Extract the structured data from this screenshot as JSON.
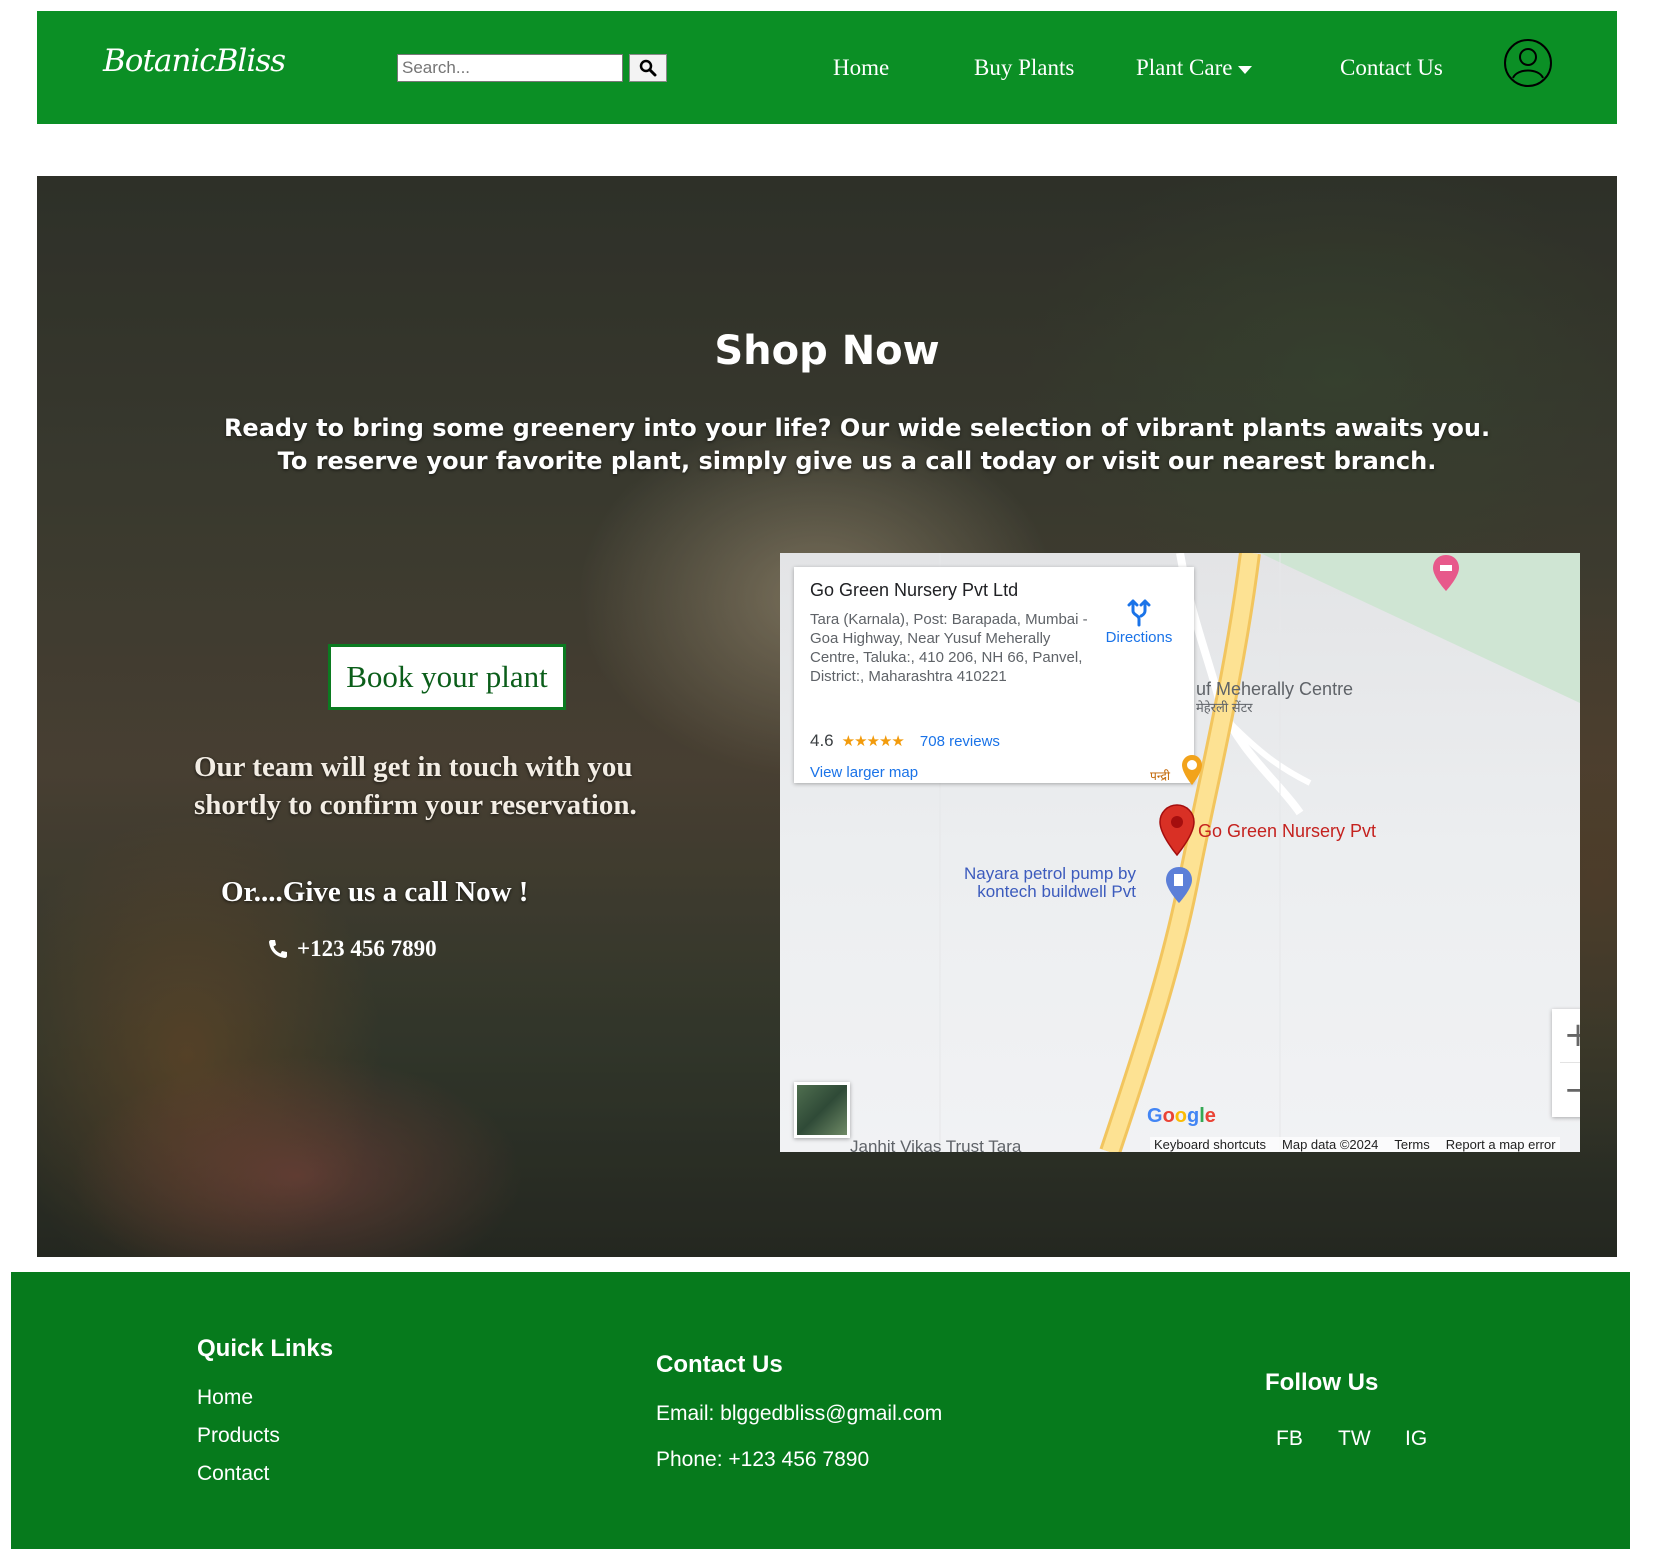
{
  "header": {
    "logo": "BotanicBliss",
    "search_placeholder": "Search...",
    "nav": {
      "home": "Home",
      "buy_plants": "Buy Plants",
      "plant_care": "Plant Care",
      "contact_us": "Contact Us"
    }
  },
  "hero": {
    "title": "Shop Now",
    "description_line1": "Ready to bring some greenery into your life? Our wide selection of vibrant plants awaits you.",
    "description_line2": "To reserve your favorite plant, simply give us a call today or visit our nearest branch.",
    "book_button": "Book your plant",
    "team_line1": "Our team will get in touch with you",
    "team_line2": "shortly to confirm your reservation.",
    "call_text": "Or....Give us a call Now !",
    "phone": "+123 456 7890"
  },
  "map": {
    "place_name": "Go Green Nursery Pvt Ltd",
    "address": "Tara (Karnala), Post: Barapada, Mumbai - Goa Highway, Near Yusuf Meherally Centre, Taluka:, 410 206, NH 66, Panvel, District:, Maharashtra 410221",
    "directions": "Directions",
    "rating": "4.6",
    "stars": "★★★★★",
    "reviews": "708 reviews",
    "view_larger": "View larger map",
    "label_centre": "uf Meherally Centre",
    "label_centre_hindi": "मेहेरली सेंटर",
    "label_pandri": "पन्द्री",
    "label_nursery": "Go Green Nursery Pvt",
    "label_petrol_1": "Nayara petrol pump by",
    "label_petrol_2": "kontech buildwell Pvt",
    "label_bottom": "Janhit Vikas Trust Tara",
    "zoom_in": "+",
    "zoom_out": "−",
    "footer": {
      "shortcuts": "Keyboard shortcuts",
      "map_data": "Map data ©2024",
      "terms": "Terms",
      "report": "Report a map error"
    }
  },
  "footer": {
    "quick_links_title": "Quick Links",
    "quick_links": [
      "Home",
      "Products",
      "Contact"
    ],
    "contact_title": "Contact Us",
    "email": "Email: blggedbliss@gmail.com",
    "phone": "Phone: +123 456 7890",
    "follow_title": "Follow Us",
    "social": [
      "FB",
      "TW",
      "IG"
    ]
  },
  "colors": {
    "nav_green": "#0b8f25",
    "footer_green": "#067a1c",
    "link_blue": "#1a73e8",
    "pin_red": "#d93025"
  }
}
